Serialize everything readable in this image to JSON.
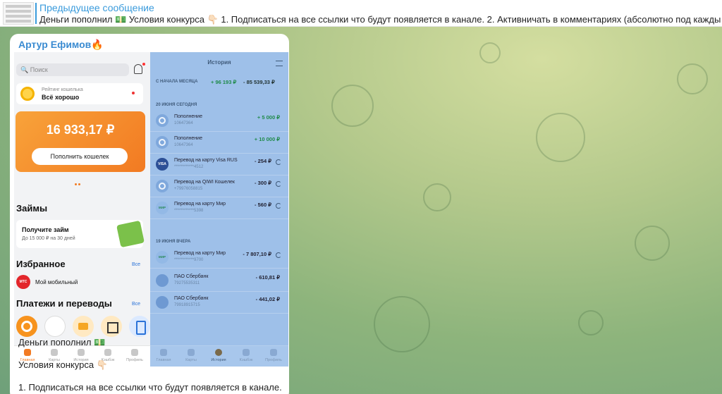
{
  "pinned": {
    "title": "Предыдущее сообщение",
    "text": "Деньги пополнил 💵  Условия конкурса 👇🏻  1. Подписаться на все ссылки что будут появляется в канале. 2. Активничать в комментариях (абсолютно под каждым посто"
  },
  "message": {
    "author": "Артур Ефимов🔥",
    "line1": "Деньги пополнил 💵",
    "line2": "Условия конкурса 👇🏻",
    "line3": "1. Подписаться на все ссылки что будут появляется в канале."
  },
  "wallet": {
    "search_placeholder": "Поиск",
    "rating_title": "Рейтинг кошелька",
    "rating_status": "Всё хорошо",
    "balance": "16 933,17 ₽",
    "topup_button": "Пополнить кошелек",
    "loans_heading": "Займы",
    "loan_title": "Получите займ",
    "loan_sub": "До 15 000 ₽ на 30 дней",
    "favorites_heading": "Избранное",
    "favorites_all": "Все",
    "fav_icon_text": "МТС",
    "fav_item": "Мой мобильный",
    "payments_heading": "Платежи и переводы",
    "payments_all": "Все",
    "tabs": [
      "Главная",
      "Карты",
      "История",
      "Кэшбэк",
      "Профиль"
    ]
  },
  "history": {
    "title": "История",
    "month_label": "С НАЧАЛА МЕСЯЦА",
    "month_in": "+ 96 193 ₽",
    "month_out": "- 85 539,33 ₽",
    "day1": "20 ИЮНЯ   СЕГОДНЯ",
    "day2": "19 ИЮНЯ   ВЧЕРА",
    "tx": [
      {
        "name": "Пополнение",
        "sub": "10647364",
        "sum": "+ 5 000 ₽",
        "icon": "qiwi-icon"
      },
      {
        "name": "Пополнение",
        "sub": "10647364",
        "sum": "+ 10 000 ₽",
        "icon": "qiwi-icon"
      },
      {
        "name": "Перевод на карту Visa RUS",
        "sub": "************4512",
        "sum": "- 254 ₽",
        "icon": "visa-icon",
        "badge": "VISA"
      },
      {
        "name": "Перевод на QIWI Кошелек",
        "sub": "+79976058815",
        "sum": "- 300 ₽",
        "icon": "qiwi-icon"
      },
      {
        "name": "Перевод на карту Мир",
        "sub": "************5398",
        "sum": "- 560 ₽",
        "icon": "mir-icon",
        "badge": "МИР"
      },
      {
        "name": "Перевод на карту Мир",
        "sub": "************9700",
        "sum": "- 7 807,10 ₽",
        "icon": "mir-icon",
        "badge": "МИР"
      },
      {
        "name": "ПАО Сбербанк",
        "sub": "79275535311",
        "sum": "- 610,81 ₽",
        "icon": "sberbank-icon"
      },
      {
        "name": "ПАО Сбербанк",
        "sub": "79918915715",
        "sum": "- 441,02 ₽",
        "icon": "sberbank-icon"
      }
    ],
    "tabs": [
      "Главная",
      "Карты",
      "История",
      "Кэшбэк",
      "Профиль"
    ]
  },
  "colors": {
    "link": "#3a9bdc",
    "author": "#3a8bd1",
    "accent_orange": "#f27a22",
    "history_bg": "#9ec0e9",
    "income": "#1f8a4a"
  }
}
